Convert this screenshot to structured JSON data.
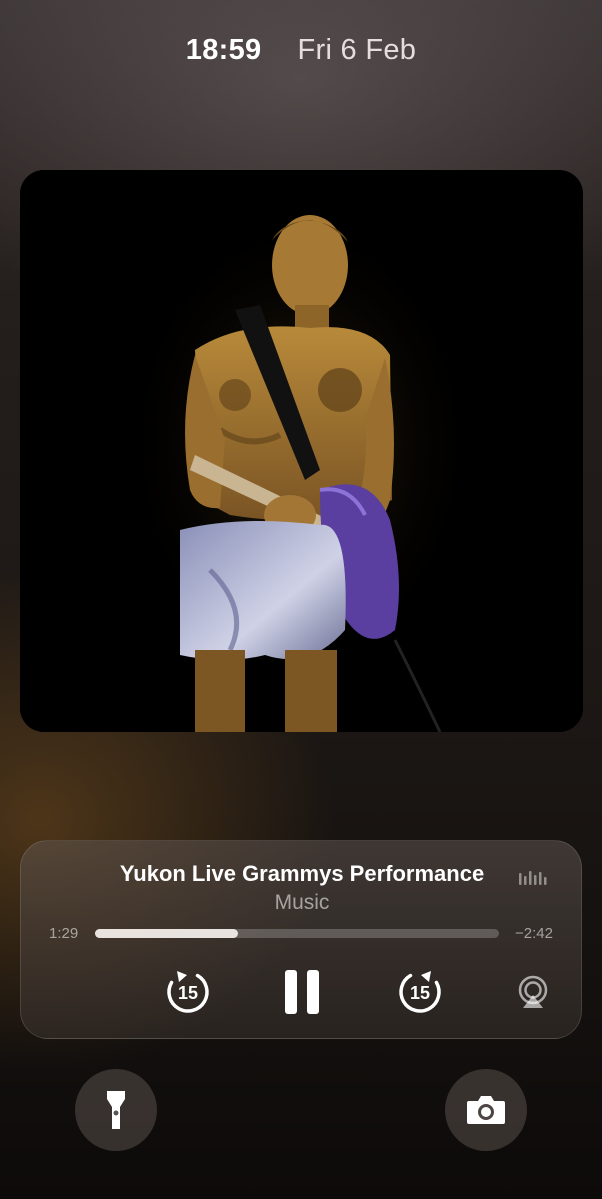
{
  "status": {
    "time": "18:59",
    "date": "Fri 6 Feb"
  },
  "artwork": {
    "description_icon": "album-artwork"
  },
  "player": {
    "title": "Yukon Live Grammys Performance",
    "source": "Music",
    "elapsed": "1:29",
    "remaining": "−2:42",
    "progress_fraction": 0.355,
    "skip_back_seconds": "15",
    "skip_forward_seconds": "15",
    "icons": {
      "waveform": "audio-waveform-icon",
      "skip_back": "skip-back-15-icon",
      "pause": "pause-icon",
      "skip_forward": "skip-forward-15-icon",
      "airplay": "airplay-icon"
    }
  },
  "quick_actions": {
    "left": "flashlight-icon",
    "right": "camera-icon"
  },
  "colors": {
    "progress_fill": "#e9e3df",
    "progress_track": "rgba(255,255,255,0.22)"
  }
}
